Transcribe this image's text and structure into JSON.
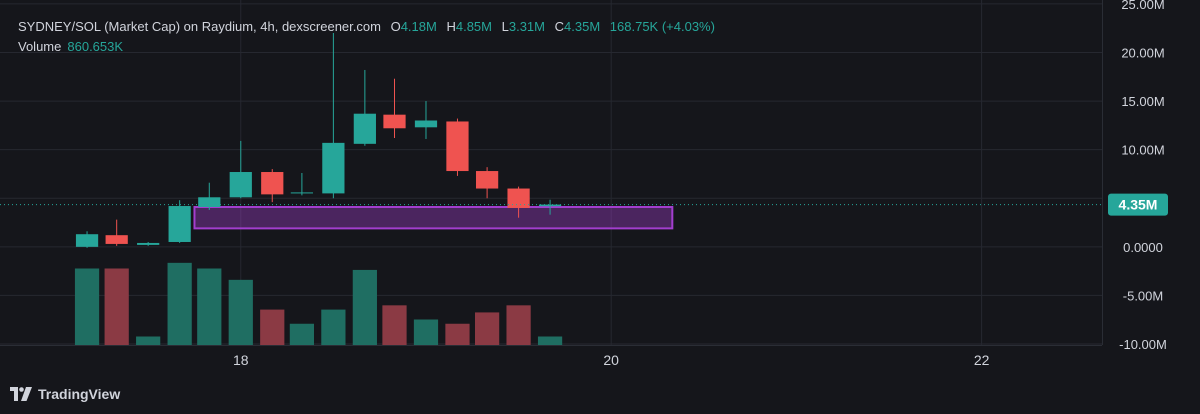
{
  "legend": {
    "symbol": "SYDNEY/SOL (Market Cap) on Raydium, 4h, dexscreener.com",
    "open_label": "O",
    "open": "4.18M",
    "high_label": "H",
    "high": "4.85M",
    "low_label": "L",
    "low": "3.31M",
    "close_label": "C",
    "close": "4.35M",
    "change": "168.75K (+4.03%)",
    "volume_label": "Volume",
    "volume": "860.653K"
  },
  "brand": {
    "name": "TradingView"
  },
  "colors": {
    "up": "#26a69a",
    "down": "#ef5350",
    "up_volume": "#1f6e62",
    "down_volume": "#8b3a44",
    "zone": "#a33ecf",
    "grid": "#262830",
    "background": "#15161b"
  },
  "chart_data": {
    "type": "candlestick",
    "y_ticks": [
      "25.00M",
      "20.00M",
      "15.00M",
      "10.00M",
      "5.00M",
      "0.0000",
      "-5.00M",
      "-10.00M"
    ],
    "y_tick_values": [
      25,
      20,
      15,
      10,
      5,
      0,
      -5,
      -10
    ],
    "ylim": [
      -10.1,
      25.4
    ],
    "x_ticks": [
      "18",
      "20",
      "22"
    ],
    "x_tick_values": [
      18,
      20,
      22
    ],
    "xlim": [
      16.7,
      22.65
    ],
    "last_price_label": "4.35M",
    "last_price": 4.35,
    "candles": [
      {
        "t": 17.17,
        "o": 0.0,
        "h": 1.6,
        "l": -0.1,
        "c": 1.3
      },
      {
        "t": 17.33,
        "o": 1.2,
        "h": 2.8,
        "l": 0.1,
        "c": 0.3
      },
      {
        "t": 17.5,
        "o": 0.2,
        "h": 0.5,
        "l": 0.1,
        "c": 0.4
      },
      {
        "t": 17.67,
        "o": 0.5,
        "h": 4.8,
        "l": 0.4,
        "c": 4.2
      },
      {
        "t": 17.83,
        "o": 4.1,
        "h": 6.6,
        "l": 3.8,
        "c": 5.1
      },
      {
        "t": 18.0,
        "o": 5.1,
        "h": 10.9,
        "l": 5.0,
        "c": 7.7
      },
      {
        "t": 18.17,
        "o": 7.7,
        "h": 8.0,
        "l": 4.6,
        "c": 5.4
      },
      {
        "t": 18.33,
        "o": 5.5,
        "h": 7.6,
        "l": 5.3,
        "c": 5.6
      },
      {
        "t": 18.5,
        "o": 5.5,
        "h": 22.0,
        "l": 5.0,
        "c": 10.7
      },
      {
        "t": 18.67,
        "o": 10.6,
        "h": 18.2,
        "l": 10.4,
        "c": 13.7
      },
      {
        "t": 18.83,
        "o": 13.6,
        "h": 17.3,
        "l": 11.2,
        "c": 12.2
      },
      {
        "t": 19.0,
        "o": 12.3,
        "h": 15.0,
        "l": 11.1,
        "c": 13.0
      },
      {
        "t": 19.17,
        "o": 12.9,
        "h": 13.2,
        "l": 7.3,
        "c": 7.8
      },
      {
        "t": 19.33,
        "o": 7.8,
        "h": 8.2,
        "l": 5.0,
        "c": 6.0
      },
      {
        "t": 19.5,
        "o": 6.0,
        "h": 6.2,
        "l": 3.0,
        "c": 4.0
      },
      {
        "t": 19.67,
        "o": 4.18,
        "h": 4.85,
        "l": 3.31,
        "c": 4.35
      }
    ],
    "volume": [
      {
        "t": 17.17,
        "v": 0.54,
        "dir": "up"
      },
      {
        "t": 17.33,
        "v": 0.54,
        "dir": "down"
      },
      {
        "t": 17.5,
        "v": 0.06,
        "dir": "up"
      },
      {
        "t": 17.67,
        "v": 0.58,
        "dir": "up"
      },
      {
        "t": 17.83,
        "v": 0.54,
        "dir": "up"
      },
      {
        "t": 18.0,
        "v": 0.46,
        "dir": "up"
      },
      {
        "t": 18.17,
        "v": 0.25,
        "dir": "down"
      },
      {
        "t": 18.33,
        "v": 0.15,
        "dir": "up"
      },
      {
        "t": 18.5,
        "v": 0.25,
        "dir": "up"
      },
      {
        "t": 18.67,
        "v": 0.53,
        "dir": "up"
      },
      {
        "t": 18.83,
        "v": 0.28,
        "dir": "down"
      },
      {
        "t": 19.0,
        "v": 0.18,
        "dir": "up"
      },
      {
        "t": 19.17,
        "v": 0.15,
        "dir": "down"
      },
      {
        "t": 19.33,
        "v": 0.23,
        "dir": "down"
      },
      {
        "t": 19.5,
        "v": 0.28,
        "dir": "down"
      },
      {
        "t": 19.67,
        "v": 0.06,
        "dir": "up"
      }
    ],
    "zone": {
      "t_start": 17.75,
      "t_end": 20.33,
      "low": 1.9,
      "high": 4.1
    }
  }
}
